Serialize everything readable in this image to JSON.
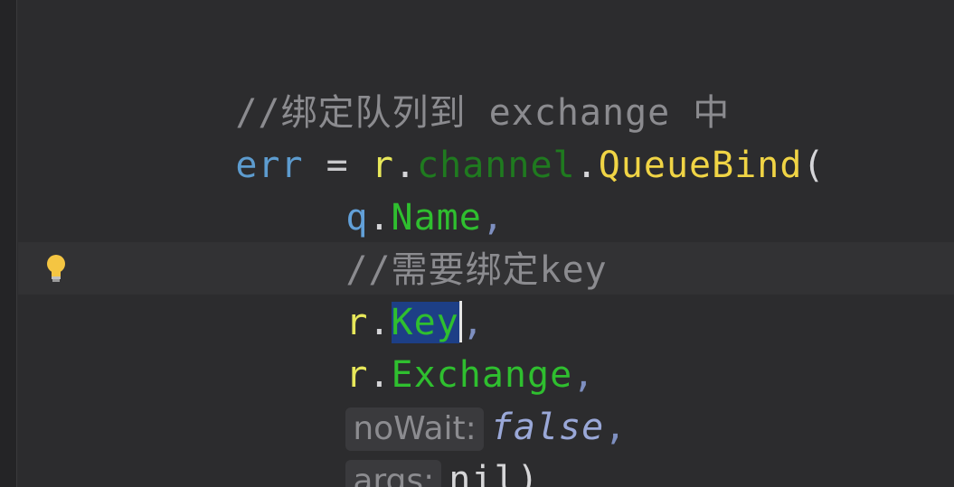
{
  "code": {
    "line1": {
      "comment": "//绑定队列到 exchange 中"
    },
    "line2": {
      "var": "err",
      "assign": "=",
      "recv": "r",
      "dot": ".",
      "field": "channel",
      "method": "QueueBind",
      "paren": "("
    },
    "line3": {
      "recv": "q",
      "dot": ".",
      "field": "Name",
      "comma": ","
    },
    "line4": {
      "comment": "//需要绑定key"
    },
    "line5": {
      "recv": "r",
      "dot": ".",
      "field_selected": "Key",
      "comma": ","
    },
    "line6": {
      "recv": "r",
      "dot": ".",
      "field": "Exchange",
      "comma": ","
    },
    "line7": {
      "hint": "noWait:",
      "value": "false",
      "comma": ","
    },
    "line8": {
      "hint": "args:",
      "value": "nil",
      "paren": ")"
    }
  },
  "gutter": {
    "icon": "lightbulb-icon"
  },
  "colors": {
    "background": "#2c2c2e",
    "selection": "#1d3f86",
    "field": "#2fbf2f",
    "method": "#f0d445"
  }
}
